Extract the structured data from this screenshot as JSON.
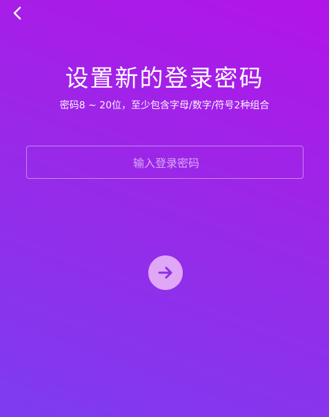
{
  "header": {
    "back_icon": "chevron-left-icon"
  },
  "main": {
    "title": "设置新的登录密码",
    "subtitle": "密码8 ~ 20位，至少包含字母/数字/符号2种组合",
    "password_placeholder": "输入登录密码",
    "password_value": "",
    "submit_icon": "arrow-right-icon"
  },
  "colors": {
    "gradient_top": "#b214e8",
    "gradient_bottom": "#7d3cf0",
    "button_bg": "#e0a7f6",
    "arrow_color": "#8a2fe6"
  }
}
